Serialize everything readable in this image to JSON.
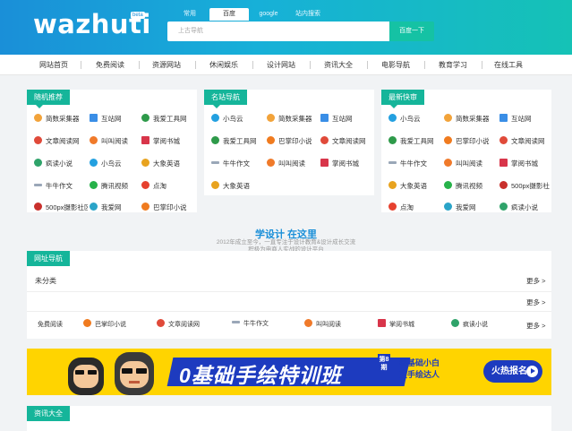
{
  "header": {
    "logo": "wazhuti",
    "beta": "beta",
    "search_tabs": [
      "常用",
      "百度",
      "google",
      "站内搜索"
    ],
    "search_placeholder": "上古导航",
    "search_button": "百度一下"
  },
  "nav": [
    "网站首页",
    "免费阅读",
    "资源网站",
    "休闲娱乐",
    "设计网站",
    "资讯大全",
    "电影导航",
    "教育学习",
    "在线工具"
  ],
  "cards": [
    {
      "title": "随机推荐",
      "items": [
        {
          "label": "简数采集器",
          "icon": "paper-plane-icon",
          "color": "#f2a33a"
        },
        {
          "label": "互站网",
          "icon": "stack-icon",
          "color": "#3a8ee6"
        },
        {
          "label": "我爱工具网",
          "icon": "wrench-icon",
          "color": "#2e9a4a"
        },
        {
          "label": "文章阅读网",
          "icon": "sun-icon",
          "color": "#e04a3a"
        },
        {
          "label": "叫叫阅读",
          "icon": "bubble-icon",
          "color": "#f07a2a"
        },
        {
          "label": "掌阅书城",
          "icon": "book-icon",
          "color": "#d8354a"
        },
        {
          "label": "疯读小说",
          "icon": "wheel-icon",
          "color": "#2fa36a"
        },
        {
          "label": "小鸟云",
          "icon": "bird-icon",
          "color": "#23a0e0"
        },
        {
          "label": "大象英语",
          "icon": "elephant-icon",
          "color": "#e8a31f"
        },
        {
          "label": "牛牛作文",
          "icon": "pen-icon",
          "color": "#9aa7b8"
        },
        {
          "label": "腾讯视频",
          "icon": "play-icon",
          "color": "#27b24a"
        },
        {
          "label": "点淘",
          "icon": "target-icon",
          "color": "#e6412f"
        },
        {
          "label": "500px摄影社区",
          "icon": "500px-icon",
          "color": "#c9302c"
        },
        {
          "label": "我爱网",
          "icon": "bird-w-icon",
          "color": "#2aa4c8"
        },
        {
          "label": "巴掌印小说",
          "icon": "paw-icon",
          "color": "#f07b1f"
        }
      ]
    },
    {
      "title": "名站导航",
      "items": [
        {
          "label": "小鸟云",
          "icon": "bird-icon",
          "color": "#23a0e0"
        },
        {
          "label": "简数采集器",
          "icon": "paper-plane-icon",
          "color": "#f2a33a"
        },
        {
          "label": "互站网",
          "icon": "stack-icon",
          "color": "#3a8ee6"
        },
        {
          "label": "我爱工具网",
          "icon": "wrench-icon",
          "color": "#2e9a4a"
        },
        {
          "label": "巴掌印小说",
          "icon": "paw-icon",
          "color": "#f07b1f"
        },
        {
          "label": "文章阅读网",
          "icon": "sun-icon",
          "color": "#e04a3a"
        },
        {
          "label": "牛牛作文",
          "icon": "pen-icon",
          "color": "#9aa7b8"
        },
        {
          "label": "叫叫阅读",
          "icon": "bubble-icon",
          "color": "#f07a2a"
        },
        {
          "label": "掌阅书城",
          "icon": "book-icon",
          "color": "#d8354a"
        },
        {
          "label": "大象英语",
          "icon": "elephant-icon",
          "color": "#e8a31f"
        }
      ]
    },
    {
      "title": "最新快审",
      "items": [
        {
          "label": "小鸟云",
          "icon": "bird-icon",
          "color": "#23a0e0"
        },
        {
          "label": "简数采集器",
          "icon": "paper-plane-icon",
          "color": "#f2a33a"
        },
        {
          "label": "互站网",
          "icon": "stack-icon",
          "color": "#3a8ee6"
        },
        {
          "label": "我爱工具网",
          "icon": "wrench-icon",
          "color": "#2e9a4a"
        },
        {
          "label": "巴掌印小说",
          "icon": "paw-icon",
          "color": "#f07b1f"
        },
        {
          "label": "文章阅读网",
          "icon": "sun-icon",
          "color": "#e04a3a"
        },
        {
          "label": "牛牛作文",
          "icon": "pen-icon",
          "color": "#9aa7b8"
        },
        {
          "label": "叫叫阅读",
          "icon": "bubble-icon",
          "color": "#f07a2a"
        },
        {
          "label": "掌阅书城",
          "icon": "book-icon",
          "color": "#d8354a"
        },
        {
          "label": "大象英语",
          "icon": "elephant-icon",
          "color": "#e8a31f"
        },
        {
          "label": "腾讯视频",
          "icon": "play-icon",
          "color": "#27b24a"
        },
        {
          "label": "500px摄影社区",
          "icon": "500px-icon",
          "color": "#c9302c"
        },
        {
          "label": "点淘",
          "icon": "target-icon",
          "color": "#e6412f"
        },
        {
          "label": "我爱网",
          "icon": "bird-w-icon",
          "color": "#2aa4c8"
        },
        {
          "label": "疯读小说",
          "icon": "wheel-icon",
          "color": "#2fa36a"
        }
      ]
    }
  ],
  "slogan": {
    "main": "学设计 在这里",
    "sub1": "2012年成立至今，一直专注于设计教育&设计成长交流",
    "sub2": "积极为电商人实战的设计平台"
  },
  "url_nav": {
    "title": "网址导航",
    "uncategorized": "未分类",
    "more": "更多 >",
    "row_label": "免费阅读",
    "row_items": [
      {
        "label": "巴掌印小说",
        "icon": "paw-icon",
        "color": "#f07b1f"
      },
      {
        "label": "文章阅读网",
        "icon": "sun-icon",
        "color": "#e04a3a"
      },
      {
        "label": "牛牛作文",
        "icon": "pen-icon",
        "color": "#9aa7b8"
      },
      {
        "label": "叫叫阅读",
        "icon": "bubble-icon",
        "color": "#f07a2a"
      },
      {
        "label": "掌阅书城",
        "icon": "book-icon",
        "color": "#d8354a"
      },
      {
        "label": "疯读小说",
        "icon": "wheel-icon",
        "color": "#2fa36a"
      }
    ]
  },
  "banner": {
    "title": "0基础手绘特训班",
    "small": "第8期",
    "copy1": "零基础小白",
    "copy2": "变手绘达人",
    "button": "火热报名"
  },
  "news": {
    "title": "资讯大全"
  },
  "colors": {
    "accent": "#15b59a",
    "brand": "#1a8fd8",
    "banner_bg": "#ffd400",
    "banner_blue": "#1d3bbf"
  }
}
